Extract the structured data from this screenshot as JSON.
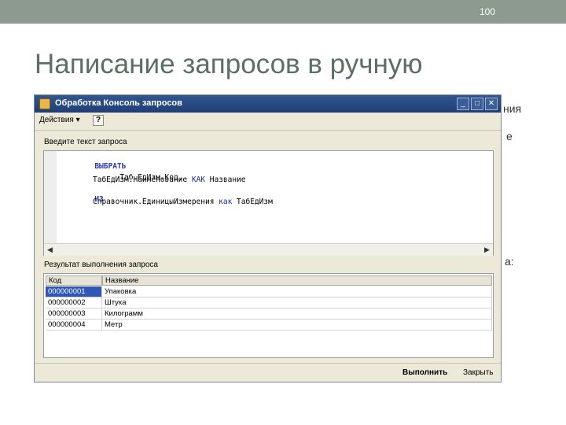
{
  "slide": {
    "page_number": "100",
    "title": "Написание запросов в ручную",
    "background_fragments": [
      "ния",
      "е",
      "а:"
    ]
  },
  "window": {
    "title": "Обработка  Консоль запросов",
    "toolbar": {
      "actions_label": "Действия ▾",
      "help_label": "?"
    },
    "title_buttons": {
      "minimize": "_",
      "maximize": "□",
      "close": "✕"
    },
    "query_section_label": "Введите текст запроса",
    "query_lines": {
      "l1_kw": "ВЫБРАТЬ",
      "l2": "Таб.ЕдИзм.Код,",
      "l3_a": "ТабЕдИзм.Наименование ",
      "l3_kw": "КАК",
      "l3_b": " Название",
      "l4_kw": "ИЗ",
      "l5_a": "Справочник.ЕдиницыИзмерения ",
      "l5_kw": "как",
      "l5_b": " ТабЕдИзм"
    },
    "result_section_label": "Результат выполнения запроса",
    "table": {
      "headers": [
        "Код",
        "Название"
      ],
      "rows": [
        [
          "000000001",
          "Упаковка"
        ],
        [
          "000000002",
          "Штука"
        ],
        [
          "000000003",
          "Килограмм"
        ],
        [
          "000000004",
          "Метр"
        ]
      ]
    },
    "footer": {
      "run_label": "Выполнить",
      "close_label": "Закрыть"
    }
  },
  "colors": {
    "topbar": "#8c9a90",
    "title": "#5c6f66",
    "selection": "#2f58b6",
    "window_title": "#1e3f75"
  }
}
